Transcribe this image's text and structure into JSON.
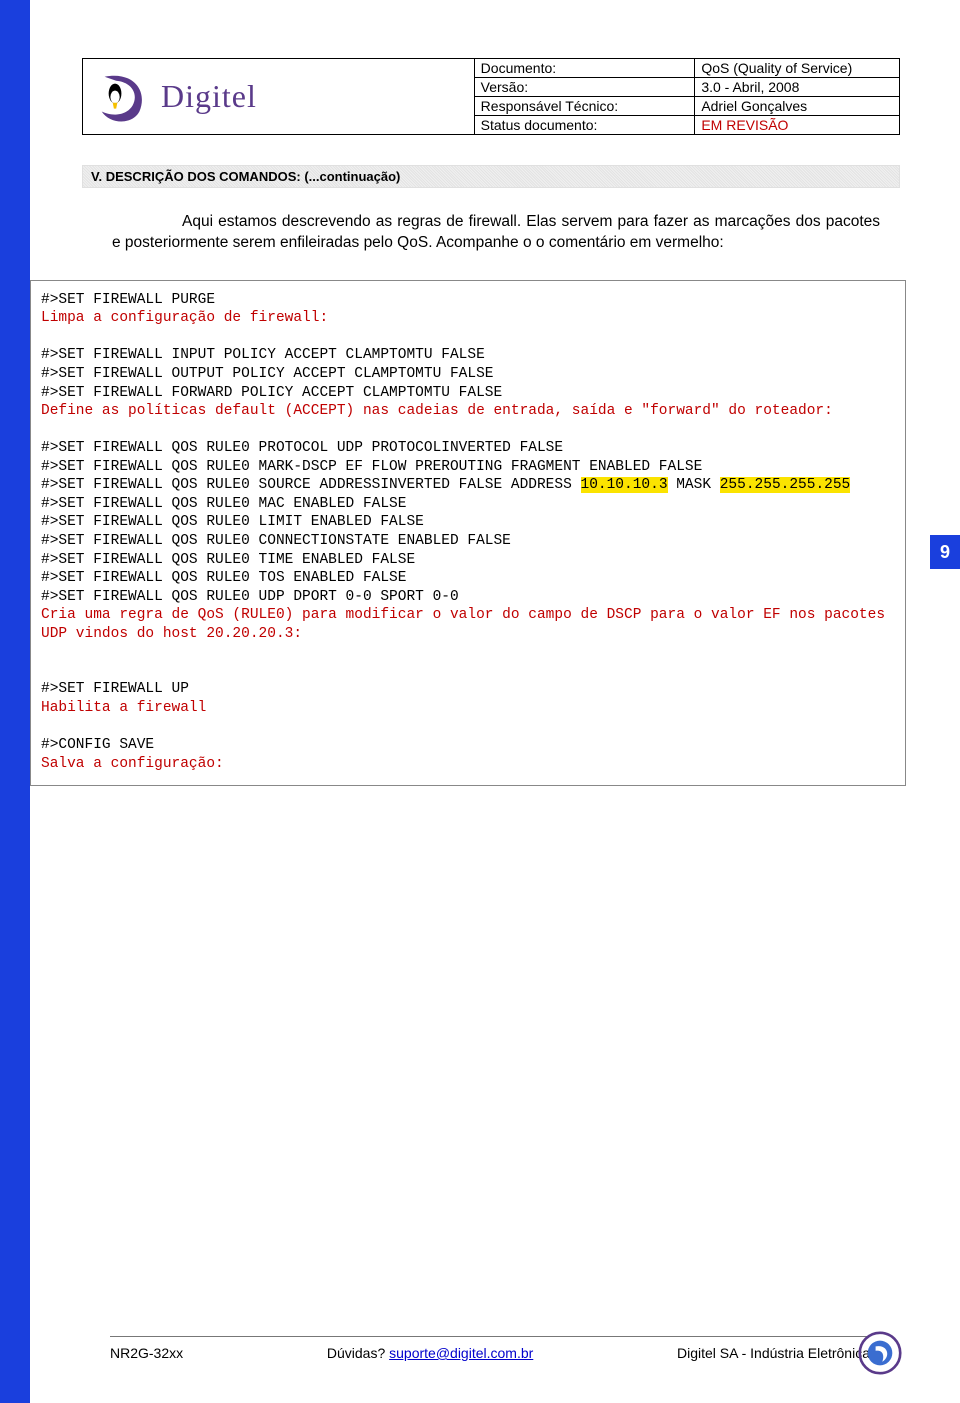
{
  "logo": {
    "text": "Digitel"
  },
  "meta": {
    "doc_label": "Documento:",
    "doc_value": "QoS (Quality of Service)",
    "ver_label": "Versão:",
    "ver_value": "3.0 - Abril, 2008",
    "resp_label": "Responsável Técnico:",
    "resp_value": "Adriel Gonçalves",
    "status_label": "Status documento:",
    "status_value": "EM REVISÃO"
  },
  "section_title": "V.  DESCRIÇÃO DOS COMANDOS:  (...continuação)",
  "intro": "Aqui estamos descrevendo as regras de firewall. Elas servem para fazer as marcações dos pacotes  e posteriormente serem enfileiradas pelo QoS. Acompanhe o o comentário em vermelho:",
  "cmd": {
    "l1": "#>SET FIREWALL PURGE",
    "c1": "Limpa a configuração de firewall:",
    "l2": "#>SET FIREWALL INPUT POLICY ACCEPT CLAMPTOMTU FALSE",
    "l3": "#>SET FIREWALL OUTPUT POLICY ACCEPT CLAMPTOMTU FALSE",
    "l4": "#>SET FIREWALL FORWARD POLICY ACCEPT CLAMPTOMTU FALSE",
    "c2": "Define as políticas default (ACCEPT) nas cadeias de entrada, saída e \"forward\" do roteador:",
    "l5": "#>SET FIREWALL QOS RULE0 PROTOCOL UDP PROTOCOLINVERTED FALSE",
    "l6": "#>SET FIREWALL QOS RULE0 MARK-DSCP EF FLOW PREROUTING FRAGMENT ENABLED FALSE",
    "l7a": "#>SET FIREWALL QOS RULE0 SOURCE ADDRESSINVERTED FALSE ADDRESS ",
    "hl1": "10.10.10.3",
    "l7b": " MASK ",
    "hl2": "255.255.255.255",
    "l8": "#>SET FIREWALL QOS RULE0 MAC ENABLED FALSE",
    "l9": "#>SET FIREWALL QOS RULE0 LIMIT ENABLED FALSE",
    "l10": "#>SET FIREWALL QOS RULE0 CONNECTIONSTATE ENABLED FALSE",
    "l11": "#>SET FIREWALL QOS RULE0 TIME ENABLED FALSE",
    "l12": "#>SET FIREWALL QOS RULE0 TOS ENABLED FALSE",
    "l13": "#>SET FIREWALL QOS RULE0 UDP DPORT 0-0 SPORT 0-0",
    "c3": "Cria uma regra de QoS (RULE0) para modificar o valor do campo de DSCP para o valor EF nos pacotes UDP vindos do host 20.20.20.3:",
    "l14": "#>SET FIREWALL UP",
    "c4": "Habilita a firewall",
    "l15": "#>CONFIG SAVE",
    "c5": "Salva a configuração:"
  },
  "page_number": "9",
  "footer": {
    "left": "NR2G-32xx",
    "mid_prefix": "Dúvidas? ",
    "mid_link": "suporte@digitel.com.br",
    "right": "Digitel SA - Indústria Eletrônica"
  }
}
